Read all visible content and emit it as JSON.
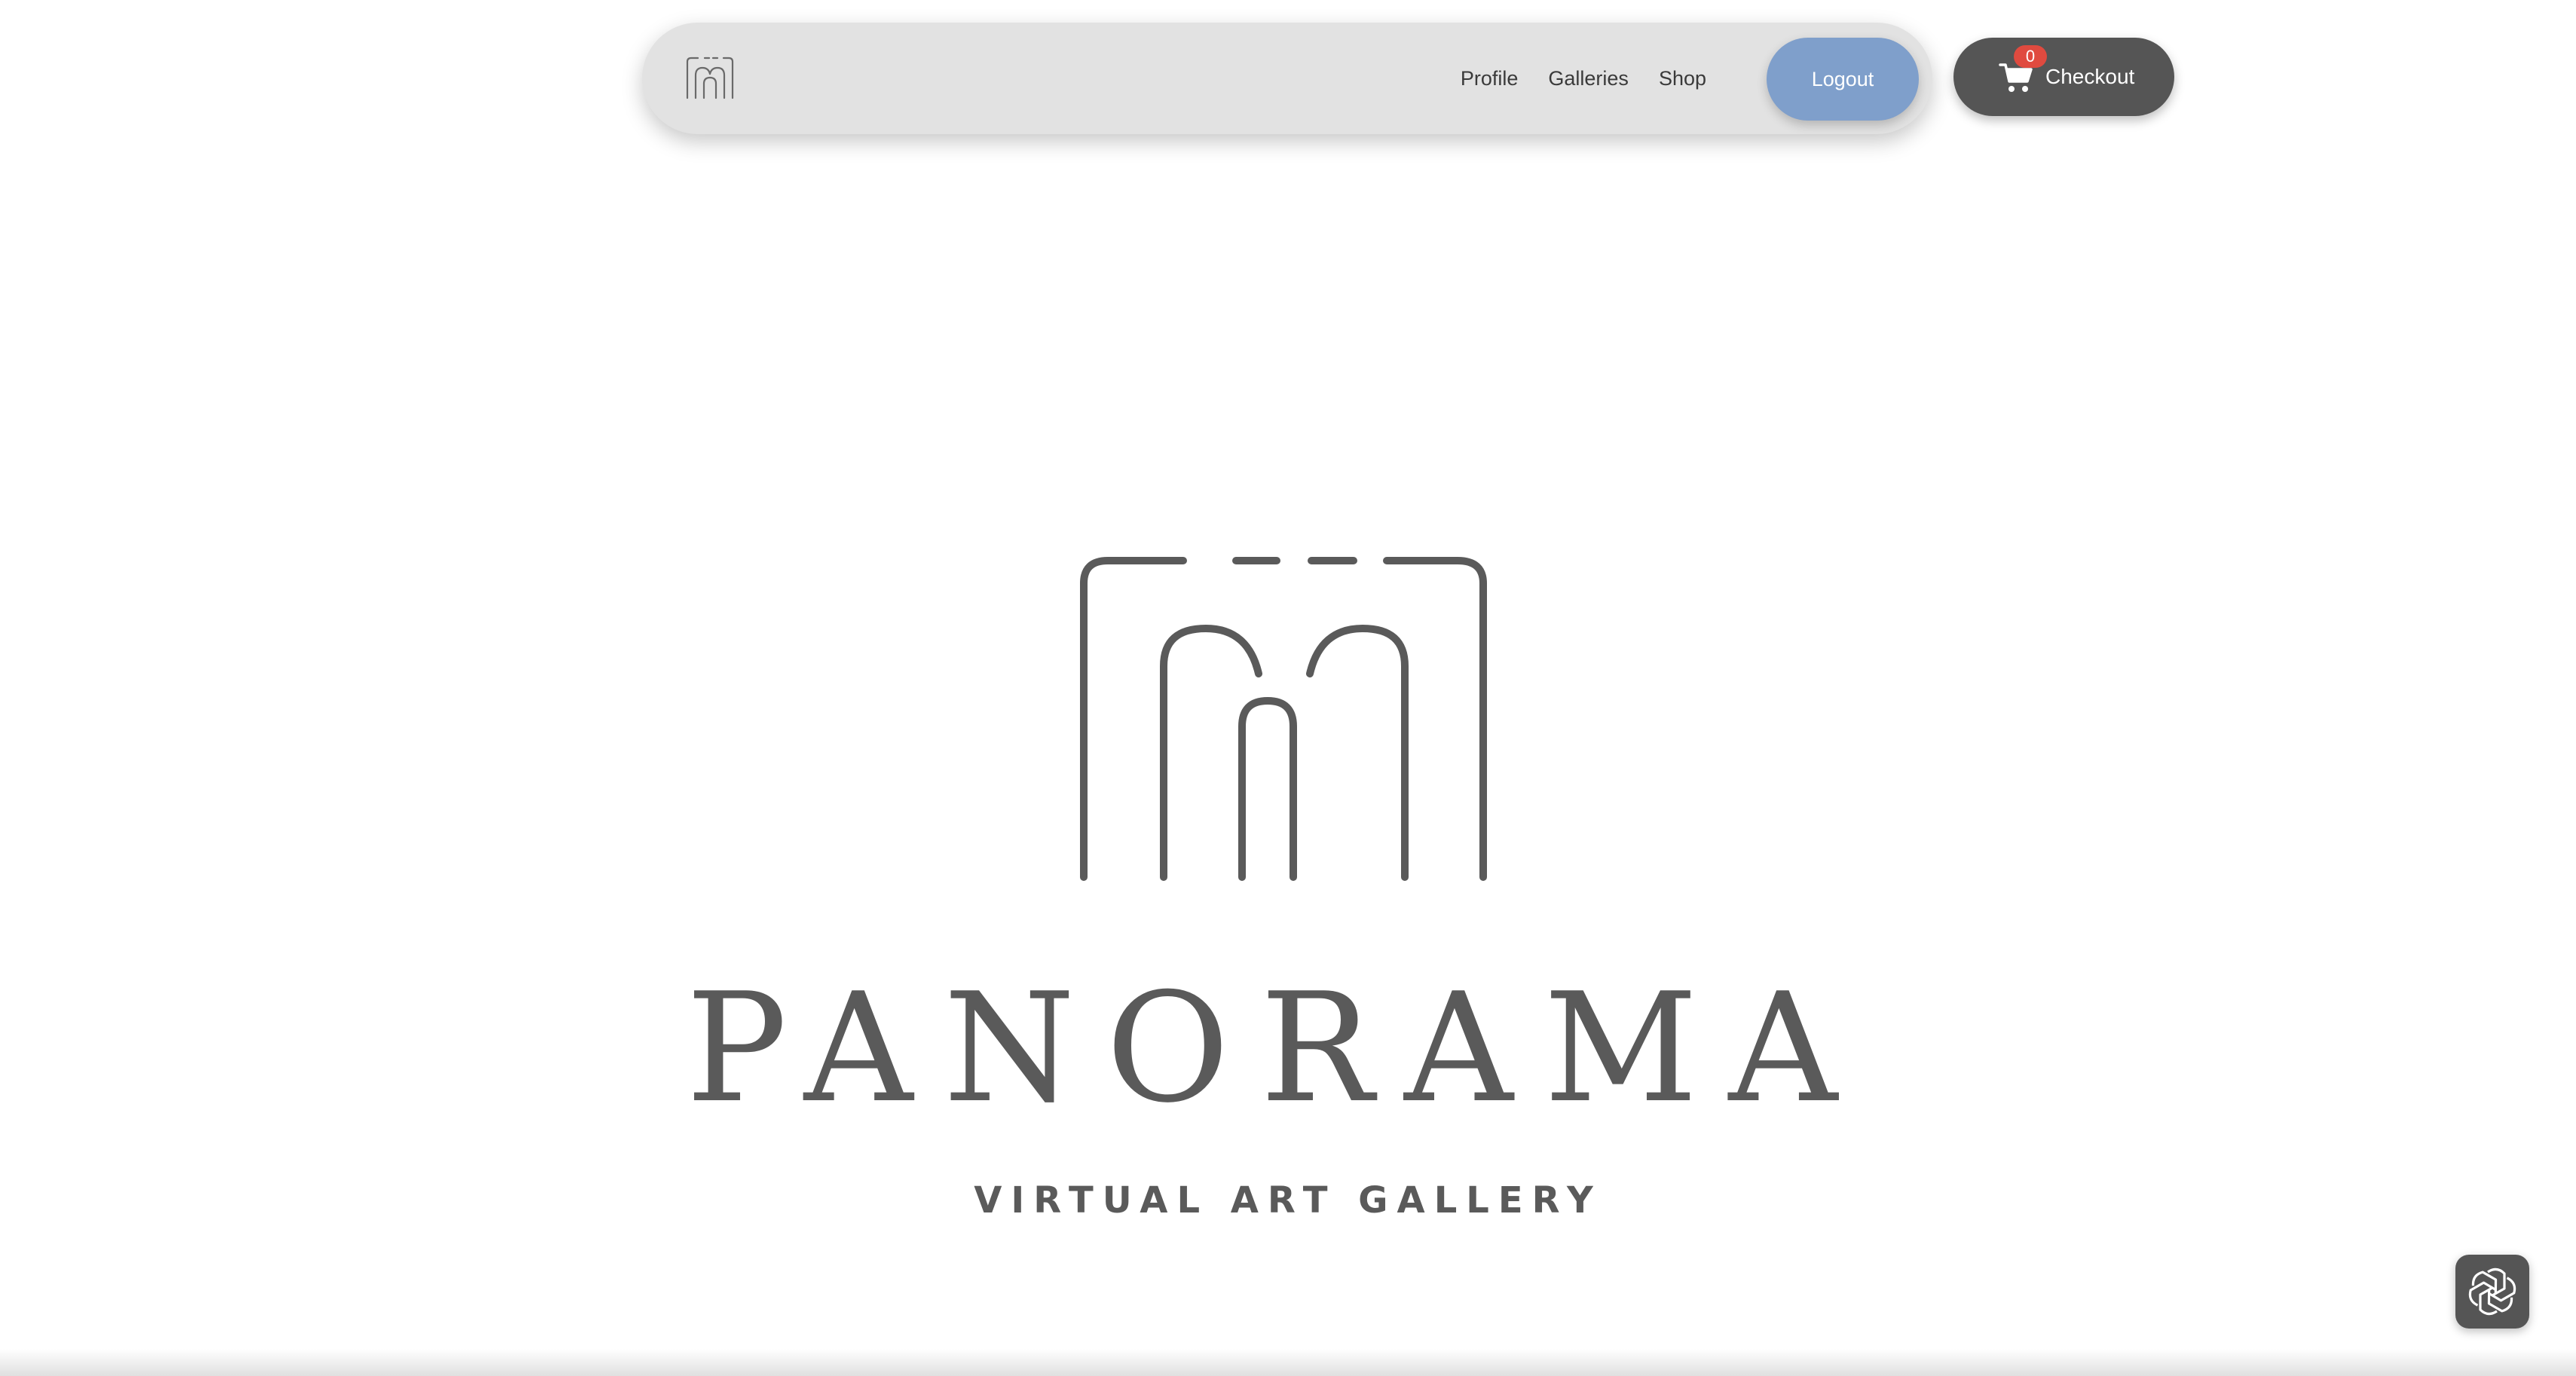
{
  "navbar": {
    "logo_icon": "panorama-logo-icon",
    "links": [
      {
        "label": "Profile"
      },
      {
        "label": "Galleries"
      },
      {
        "label": "Shop"
      }
    ],
    "logout_label": "Logout"
  },
  "checkout": {
    "label": "Checkout",
    "cart_count": "0",
    "icon": "cart-icon",
    "badge_color": "#e04a3f"
  },
  "hero": {
    "brand_name": "PANORAMA",
    "tagline": "VIRTUAL ART GALLERY"
  },
  "assistant": {
    "icon": "chatgpt-icon"
  },
  "colors": {
    "navbar_bg": "#e2e2e2",
    "logout_bg": "#7f9fcb",
    "checkout_bg": "#555555",
    "logo_gray": "#5a5a5a"
  }
}
